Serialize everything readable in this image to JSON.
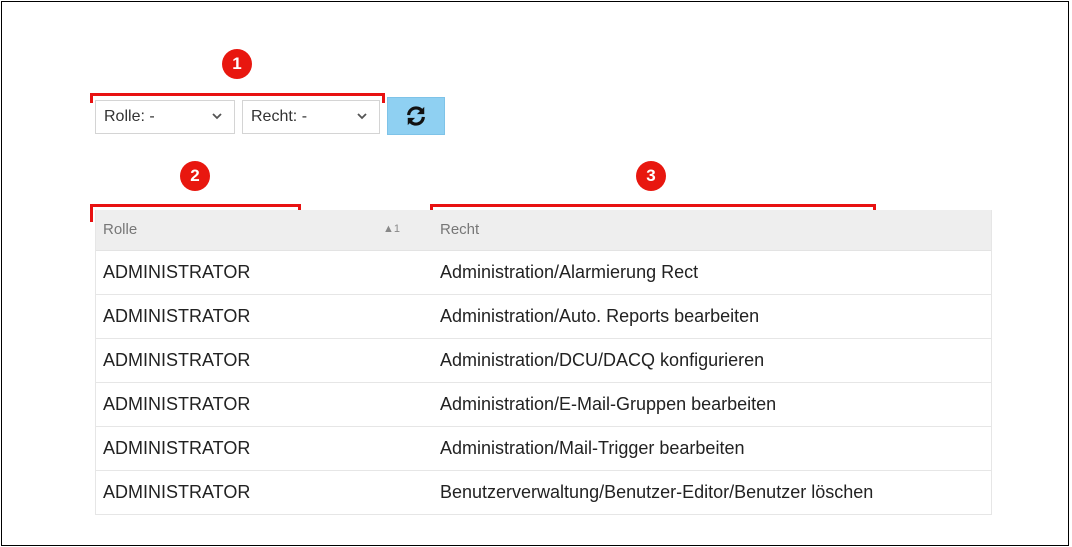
{
  "filters": {
    "role_select": {
      "value": "Rolle: -"
    },
    "right_select": {
      "value": "Recht: -"
    }
  },
  "refresh_button": {
    "icon": "refresh-icon"
  },
  "callouts": [
    "1",
    "2",
    "3"
  ],
  "table": {
    "columns": [
      {
        "label": "Rolle",
        "sort_indicator": "▲1"
      },
      {
        "label": "Recht"
      }
    ],
    "rows": [
      [
        "ADMINISTRATOR",
        "Administration/Alarmierung Rect"
      ],
      [
        "ADMINISTRATOR",
        "Administration/Auto. Reports bearbeiten"
      ],
      [
        "ADMINISTRATOR",
        "Administration/DCU/DACQ konfigurieren"
      ],
      [
        "ADMINISTRATOR",
        "Administration/E-Mail-Gruppen bearbeiten"
      ],
      [
        "ADMINISTRATOR",
        "Administration/Mail-Trigger bearbeiten"
      ],
      [
        "ADMINISTRATOR",
        "Benutzerverwaltung/Benutzer-Editor/Benutzer löschen"
      ]
    ]
  },
  "colors": {
    "callout": "#e8170f",
    "refresh_bg": "#8fd0f2",
    "header_bg": "#eeeeee"
  }
}
